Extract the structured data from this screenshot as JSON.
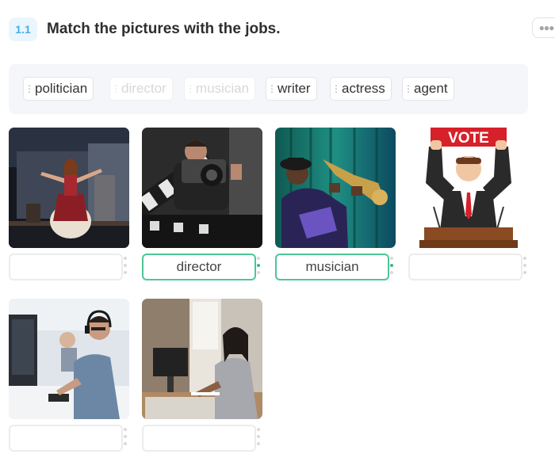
{
  "exercise": {
    "number": "1.1",
    "title": "Match the pictures with the jobs.",
    "more_icon": "ellipsis-icon"
  },
  "word_bank": [
    {
      "label": "politician",
      "used": false
    },
    {
      "label": "director",
      "used": true
    },
    {
      "label": "musician",
      "used": true
    },
    {
      "label": "writer",
      "used": false
    },
    {
      "label": "actress",
      "used": false
    },
    {
      "label": "agent",
      "used": false
    }
  ],
  "pictures": [
    {
      "subject": "actress on stage",
      "answer": ""
    },
    {
      "subject": "camera operator",
      "answer": "director"
    },
    {
      "subject": "saxophone player",
      "answer": "musician"
    },
    {
      "subject": "politician with vote sign",
      "answer": "",
      "sign_text": "VOTE"
    },
    {
      "subject": "office worker with headset",
      "answer": ""
    },
    {
      "subject": "woman writing at desk",
      "answer": ""
    }
  ],
  "colors": {
    "accent": "#49aee6",
    "filled_border": "#4bc796",
    "sign_red": "#d6202a"
  }
}
